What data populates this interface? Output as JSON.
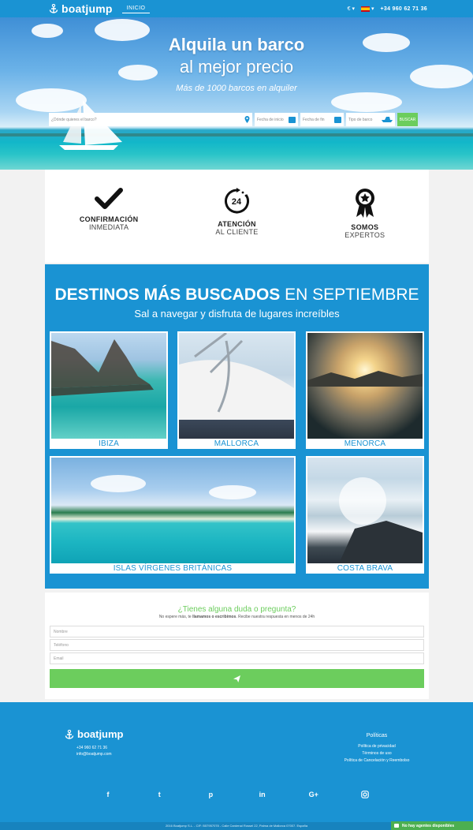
{
  "header": {
    "brand": "boatjump",
    "nav_inicio": "INICIO",
    "currency": "€ ▾",
    "lang": "▾",
    "phone": "+34 960 62 71 36"
  },
  "hero": {
    "title_line1": "Alquila un barco",
    "title_line2": "al mejor precio",
    "subtitle": "Más de 1000 barcos en alquiler",
    "search": {
      "where_placeholder": "¿Dónde quieres el barco?",
      "start_placeholder": "Fecha de inicio",
      "end_placeholder": "Fecha de fin",
      "type_placeholder": "Tipo de barco",
      "button": "BUSCAR"
    }
  },
  "features": [
    {
      "line1": "CONFIRMACIÓN",
      "line2": "INMEDIATA",
      "icon": "check-icon"
    },
    {
      "line1": "ATENCIÓN",
      "line2": "AL CLIENTE",
      "icon": "24h-support-icon",
      "badge": "24"
    },
    {
      "line1": "SOMOS",
      "line2": "EXPERTOS",
      "icon": "award-medal-icon"
    }
  ],
  "destinations": {
    "title_bold": "DESTINOS MÁS BUSCADOS",
    "title_rest": "EN SEPTIEMBRE",
    "subtitle": "Sal a navegar y disfruta de lugares increíbles",
    "items": [
      {
        "label": "IBIZA"
      },
      {
        "label": "MALLORCA"
      },
      {
        "label": "MENORCA"
      },
      {
        "label": "ISLAS VÍRGENES BRITÁNICAS"
      },
      {
        "label": "COSTA BRAVA"
      }
    ]
  },
  "contact": {
    "title": "¿Tienes alguna duda o pregunta?",
    "sub_pre": "No espere más, te ",
    "sub_bold": "llamamos o escribimos",
    "sub_post": ". Recibe nuestra respuesta en menos de 24h",
    "name_placeholder": "Nombre",
    "phone_placeholder": "Teléfono",
    "email_placeholder": "Email"
  },
  "footer": {
    "brand": "boatjump",
    "phone": "+34 960 62 71 36",
    "email": "info@boatjump.com",
    "policies_title": "Políticas",
    "links": [
      "Política de privacidad",
      "Términos de uso",
      "Política de Cancelación y Reembolso"
    ],
    "social": [
      "f",
      "t",
      "p",
      "in",
      "G+",
      "ig"
    ],
    "legal": "2016 Boatjump S.L. - CIF: B57957078 - Calle Cardenal Rossel 22, Palma de Mallorca 07007. España"
  },
  "chat": {
    "label": "No hay agentes disponibles"
  },
  "colors": {
    "primary": "#1a93d3",
    "accent_green": "#6ccd5d",
    "background": "#f2f2f2"
  }
}
